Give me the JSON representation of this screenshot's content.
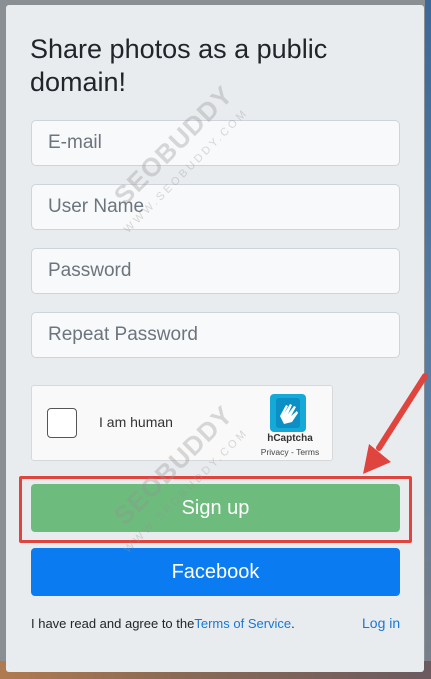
{
  "form": {
    "title": "Share photos as a public domain!",
    "email_placeholder": "E-mail",
    "username_placeholder": "User Name",
    "password_placeholder": "Password",
    "repeat_password_placeholder": "Repeat Password"
  },
  "captcha": {
    "label": "I am human",
    "brand": "hCaptcha",
    "links": "Privacy - Terms",
    "logo_icon": "hcaptcha-logo-icon",
    "checked": false
  },
  "buttons": {
    "signup": "Sign up",
    "facebook": "Facebook"
  },
  "footer": {
    "terms_prefix": "I have read and agree to the",
    "terms_link": "Terms of Service",
    "terms_suffix": ".",
    "login": "Log in"
  },
  "watermark": {
    "brand": "SEOBUDDY",
    "site": "WWW.SEOBUDDY.COM"
  },
  "colors": {
    "signup": "#6dbb7d",
    "facebook": "#0b7bf2",
    "highlight": "#e0443f",
    "link": "#1877d4"
  }
}
